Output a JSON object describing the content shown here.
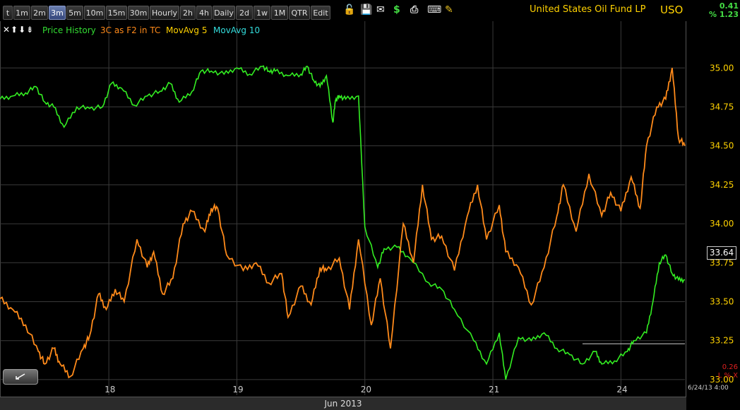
{
  "toolbar": {
    "tabs": [
      "t",
      "1m",
      "2m",
      "3m",
      "5m",
      "10m",
      "15m",
      "30m",
      "Hourly",
      "2h",
      "4h",
      "Daily",
      "2d",
      "1w",
      "1M",
      "QTR",
      "Edit"
    ],
    "active_tab": "3m",
    "icons": [
      "lock-icon",
      "save-icon",
      "mail-icon",
      "dollar-icon",
      "print-icon",
      "keyboard-icon",
      "pencil-icon"
    ]
  },
  "header": {
    "company": "United States Oil Fund LP",
    "symbol": "USO",
    "change_value": "0.41",
    "change_percent": "% 1.23"
  },
  "legend": {
    "icons_text": "✕⬆⬇⇟",
    "items": [
      {
        "label": "Price History",
        "color": "#33dd33"
      },
      {
        "label": "3C as F2 in TC",
        "color": "#ff8a1a"
      },
      {
        "label": "MovAvg 5",
        "color": "#ffd200"
      },
      {
        "label": "MovAvg 10",
        "color": "#33dddd"
      }
    ]
  },
  "footer": {
    "month_label": "Jun 2013",
    "datestamp": "6/24/13 4:00",
    "vol_value": "0.26",
    "vol_label": "L % X"
  },
  "current_price": "33.64",
  "colors": {
    "price": "#33ee22",
    "indicator": "#ff8a1a",
    "axis_text": "#ffd200",
    "grid": "#3a3a3a"
  },
  "chart_data": {
    "type": "line",
    "title": "United States Oil Fund LP",
    "xlabel": "Jun 2013",
    "ylabel": "",
    "ylim": [
      32.9,
      35.3
    ],
    "y_ticks": [
      "35.00",
      "34.75",
      "34.50",
      "34.25",
      "34.00",
      "33.75",
      "33.50",
      "33.25",
      "33.00"
    ],
    "x_ticks": [
      "18",
      "19",
      "20",
      "21",
      "24"
    ],
    "x_tick_positions": [
      1.5,
      2.5,
      3.5,
      4.5,
      5.5
    ],
    "x_range": [
      0.65,
      6.0
    ],
    "series": [
      {
        "name": "Price History",
        "x": [
          0.65,
          0.75,
          0.85,
          0.93,
          1.0,
          1.07,
          1.15,
          1.25,
          1.35,
          1.45,
          1.52,
          1.6,
          1.7,
          1.8,
          1.9,
          1.98,
          2.05,
          2.15,
          2.22,
          2.3,
          2.4,
          2.5,
          2.6,
          2.7,
          2.75,
          2.8,
          2.9,
          3.0,
          3.05,
          3.1,
          3.15,
          3.2,
          3.25,
          3.27,
          3.3,
          3.35,
          3.45,
          3.5,
          3.6,
          3.65,
          3.75,
          3.85,
          4.0,
          4.1,
          4.2,
          4.35,
          4.45,
          4.55,
          4.6,
          4.7,
          4.8,
          4.9,
          5.0,
          5.1,
          5.2,
          5.3,
          5.35,
          5.45,
          5.55,
          5.6,
          5.7,
          5.75,
          5.8,
          5.85,
          5.9,
          5.95,
          6.0
        ],
        "values": [
          34.8,
          34.82,
          34.84,
          34.88,
          34.78,
          34.75,
          34.62,
          34.75,
          34.74,
          34.75,
          34.9,
          34.87,
          34.76,
          34.82,
          34.85,
          34.9,
          34.78,
          34.85,
          34.98,
          34.98,
          34.96,
          35.0,
          34.96,
          35.01,
          34.98,
          34.98,
          34.95,
          34.96,
          35.01,
          34.92,
          34.88,
          34.95,
          34.65,
          34.79,
          34.82,
          34.8,
          34.82,
          33.98,
          33.72,
          33.84,
          33.85,
          33.78,
          33.62,
          33.58,
          33.45,
          33.25,
          33.1,
          33.3,
          33.0,
          33.27,
          33.25,
          33.3,
          33.2,
          33.16,
          33.1,
          33.18,
          33.1,
          33.12,
          33.18,
          33.25,
          33.3,
          33.5,
          33.75,
          33.8,
          33.68,
          33.64,
          33.64
        ]
      },
      {
        "name": "3C as F2 in TC",
        "x": [
          0.65,
          0.75,
          0.85,
          0.95,
          1.0,
          1.07,
          1.12,
          1.2,
          1.3,
          1.35,
          1.42,
          1.48,
          1.55,
          1.62,
          1.72,
          1.8,
          1.85,
          1.92,
          2.0,
          2.08,
          2.15,
          2.25,
          2.3,
          2.35,
          2.42,
          2.55,
          2.65,
          2.75,
          2.85,
          2.9,
          3.0,
          3.08,
          3.15,
          3.2,
          3.3,
          3.38,
          3.45,
          3.55,
          3.62,
          3.7,
          3.8,
          3.88,
          3.95,
          4.02,
          4.1,
          4.2,
          4.3,
          4.38,
          4.45,
          4.55,
          4.6,
          4.7,
          4.8,
          4.9,
          5.0,
          5.05,
          5.15,
          5.25,
          5.35,
          5.42,
          5.5,
          5.58,
          5.65,
          5.7,
          5.78,
          5.85,
          5.9,
          5.95,
          6.0
        ],
        "values": [
          33.52,
          33.45,
          33.35,
          33.18,
          33.1,
          33.2,
          33.1,
          33.02,
          33.2,
          33.28,
          33.55,
          33.45,
          33.58,
          33.5,
          33.9,
          33.72,
          33.82,
          33.55,
          33.65,
          34.0,
          34.08,
          33.95,
          34.1,
          34.1,
          33.8,
          33.7,
          33.75,
          33.62,
          33.68,
          33.4,
          33.6,
          33.48,
          33.72,
          33.7,
          33.78,
          33.45,
          33.9,
          33.35,
          33.65,
          33.2,
          34.0,
          33.75,
          34.25,
          33.9,
          33.92,
          33.7,
          34.05,
          34.25,
          33.9,
          34.12,
          33.82,
          33.72,
          33.48,
          33.72,
          34.05,
          34.25,
          33.95,
          34.32,
          34.05,
          34.2,
          34.08,
          34.3,
          34.1,
          34.5,
          34.75,
          34.8,
          35.0,
          34.55,
          34.5
        ]
      }
    ]
  }
}
